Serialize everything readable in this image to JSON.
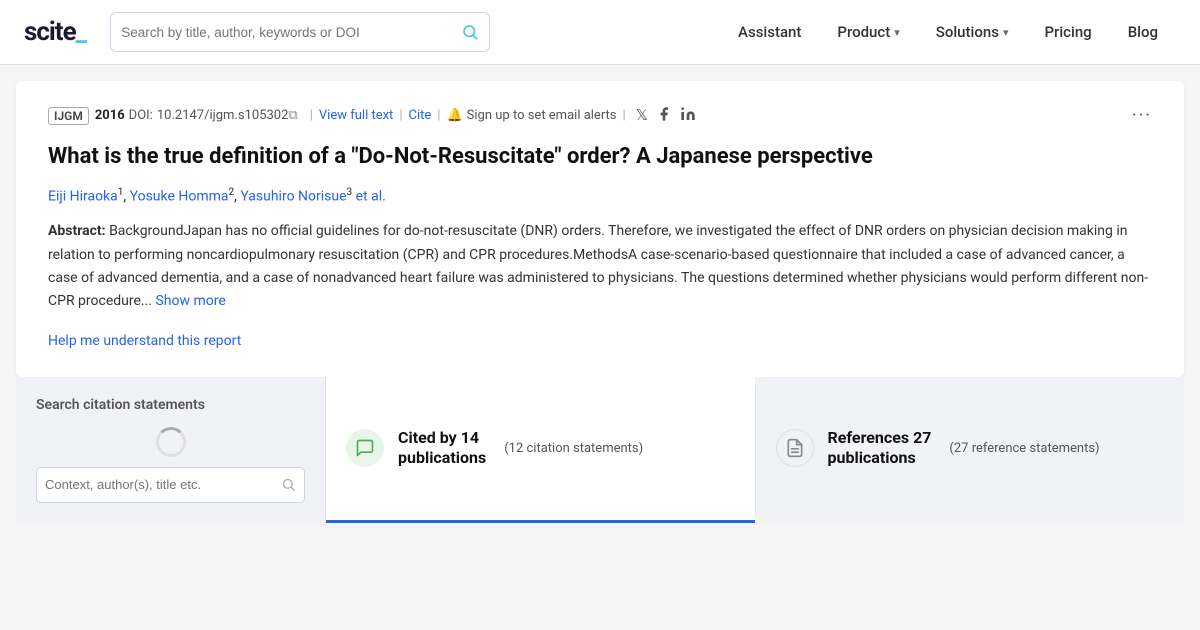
{
  "header": {
    "logo_text": "scite_",
    "search_placeholder": "Search by title, author, keywords or DOI",
    "nav_items": [
      {
        "label": "Assistant",
        "has_chevron": false
      },
      {
        "label": "Product",
        "has_chevron": true
      },
      {
        "label": "Solutions",
        "has_chevron": true
      },
      {
        "label": "Pricing",
        "has_chevron": false
      },
      {
        "label": "Blog",
        "has_chevron": false
      }
    ]
  },
  "article": {
    "journal": "IJGM",
    "year": "2016",
    "doi_label": "DOI:",
    "doi_value": "10.2147/ijgm.s105302",
    "view_full_text": "View full text",
    "cite": "Cite",
    "sign_up_text": "Sign up to set email alerts",
    "title": "What is the true definition of a &quot;Do-Not-Resuscitate&quot; order? A Japanese perspective",
    "authors": [
      {
        "name": "Eiji Hiraoka",
        "sup": "1"
      },
      {
        "name": "Yosuke Homma",
        "sup": "2"
      },
      {
        "name": "Yasuhiro Norisue",
        "sup": "3"
      }
    ],
    "et_al": "et al.",
    "abstract_label": "Abstract:",
    "abstract_text": "BackgroundJapan has no official guidelines for do-not-resuscitate (DNR) orders. Therefore, we investigated the effect of DNR orders on physician decision making in relation to performing noncardiopulmonary resuscitation (CPR) and CPR procedures.MethodsA case-scenario-based questionnaire that included a case of advanced cancer, a case of advanced dementia, and a case of nonadvanced heart failure was administered to physicians. The questions determined whether physicians would perform different non-CPR procedure...",
    "show_more": "Show more",
    "help_link": "Help me understand this report"
  },
  "citation_search": {
    "label": "Search citation statements",
    "input_placeholder": "Context, author(s), title etc."
  },
  "tabs": {
    "cited_by": {
      "label_line1": "Cited by 14",
      "label_line2": "publications",
      "sub": "(12 citation statements)"
    },
    "references": {
      "label_line1": "References 27",
      "label_line2": "publications",
      "sub": "(27 reference statements)"
    }
  }
}
